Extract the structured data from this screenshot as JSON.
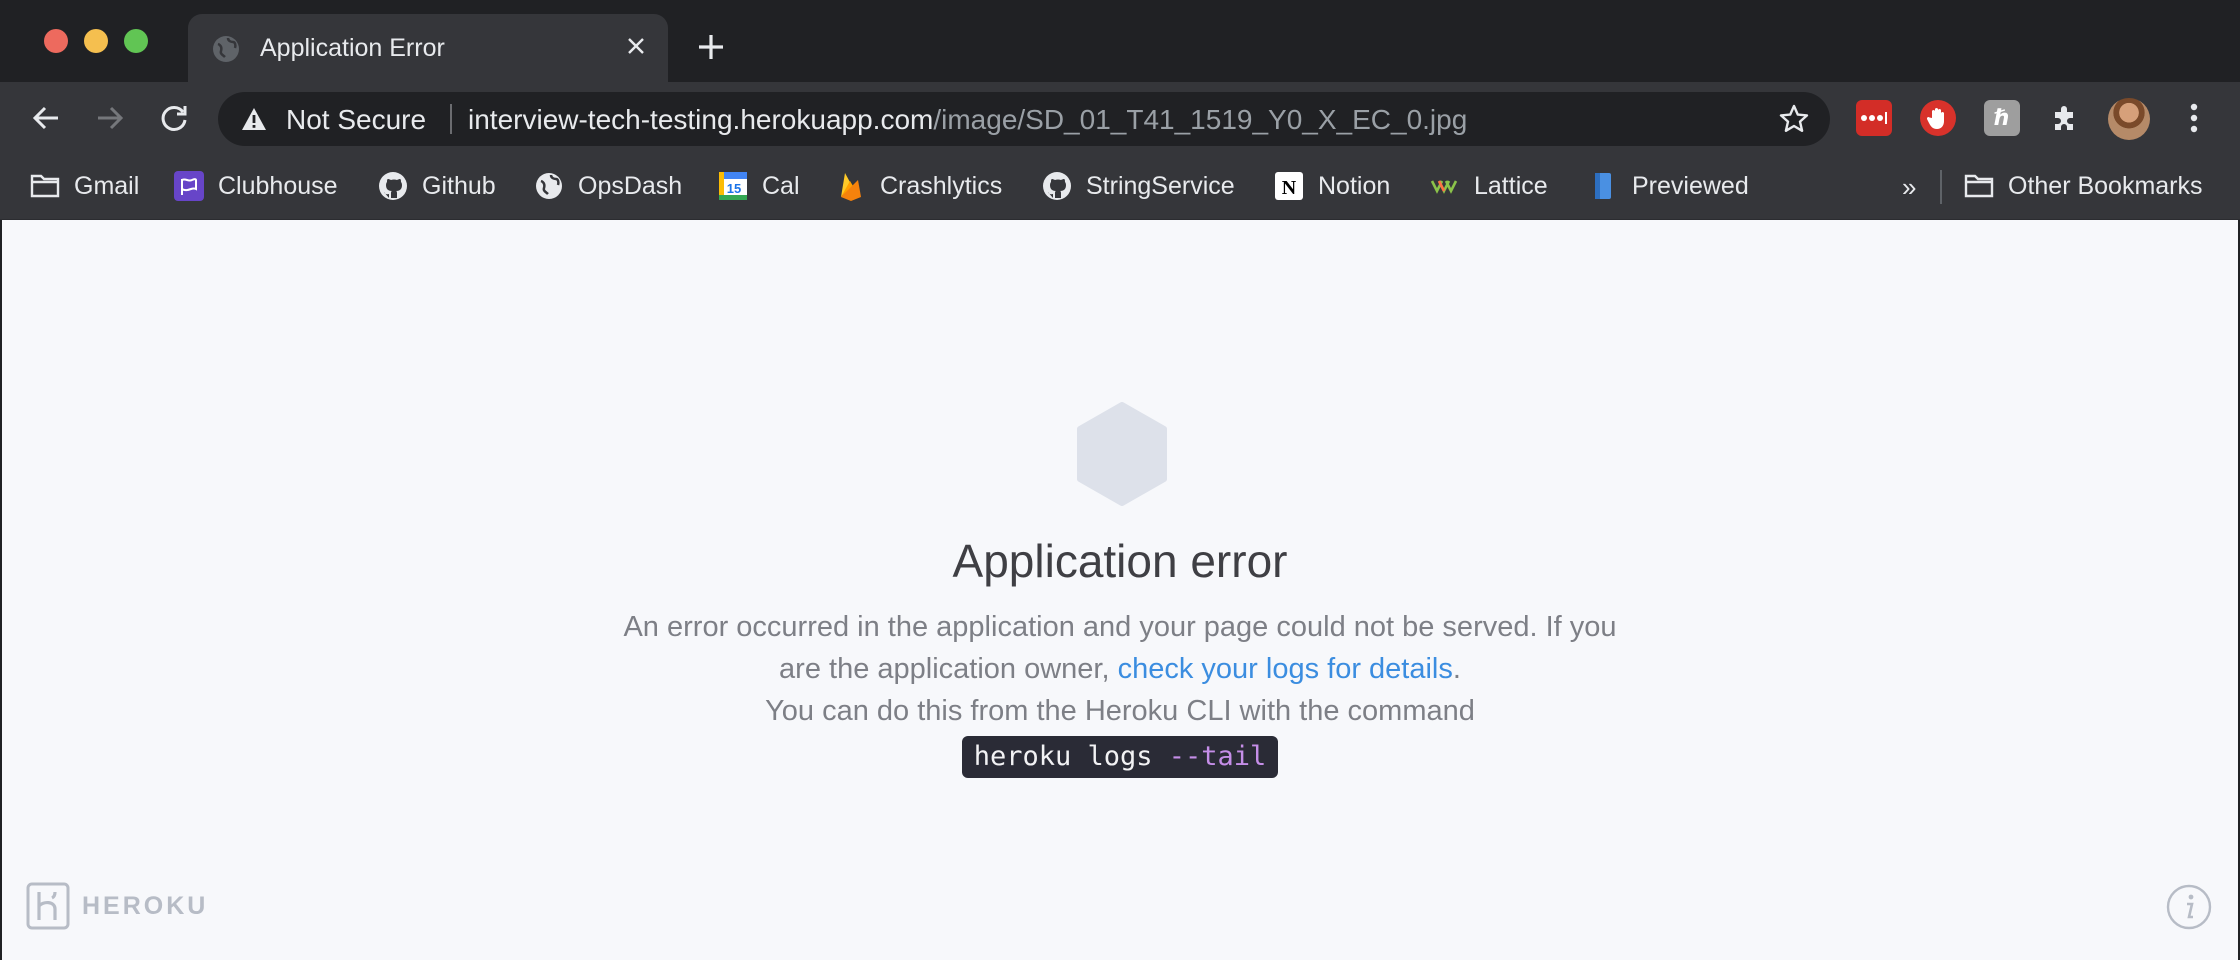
{
  "window": {
    "tab": {
      "title": "Application Error",
      "favicon": "globe-icon"
    },
    "new_tab_icon": "plus-icon"
  },
  "toolbar": {
    "security_label": "Not Secure",
    "url_host": "interview-tech-testing.herokuapp.com",
    "url_path": "/image/SD_01_T41_1519_Y0_X_EC_0.jpg"
  },
  "bookmarks": {
    "items": [
      {
        "label": "Gmail",
        "icon": "folder-icon"
      },
      {
        "label": "Clubhouse",
        "icon": "clubhouse-flag-icon"
      },
      {
        "label": "Github",
        "icon": "github-icon"
      },
      {
        "label": "OpsDash",
        "icon": "globe-icon"
      },
      {
        "label": "Cal",
        "icon": "calendar-icon",
        "badge": "15"
      },
      {
        "label": "Crashlytics",
        "icon": "firebase-icon"
      },
      {
        "label": "StringService",
        "icon": "github-icon"
      },
      {
        "label": "Notion",
        "icon": "notion-icon",
        "badge": "N"
      },
      {
        "label": "Lattice",
        "icon": "lattice-icon"
      },
      {
        "label": "Previewed",
        "icon": "bookmark-icon"
      }
    ],
    "overflow": "»",
    "other": "Other Bookmarks"
  },
  "page": {
    "title": "Application error",
    "line1": "An error occurred in the application and your page could not be served. If you are the application owner,",
    "link": "check your logs for details",
    "period": ".",
    "line2": "You can do this from the Heroku CLI with the command",
    "cmd_base": "heroku logs ",
    "cmd_flag": "--tail",
    "brand": "HEROKU"
  },
  "colors": {
    "chrome_dark": "#202124",
    "chrome_toolbar": "#35363a",
    "page_bg": "#f7f8fb",
    "link": "#3b8de0",
    "hex": "#dde1ea"
  }
}
